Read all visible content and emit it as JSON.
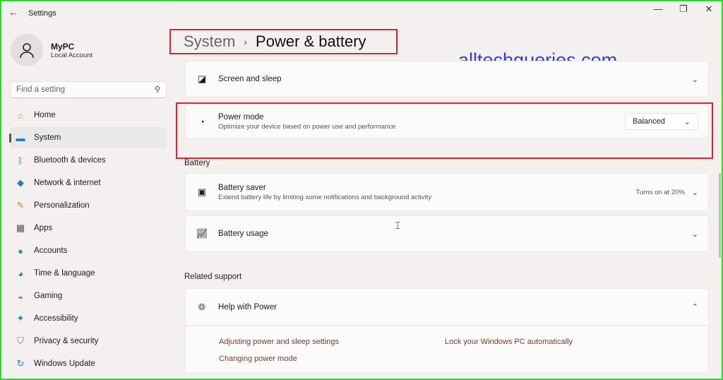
{
  "window": {
    "title": "Settings",
    "back_icon": "arrow-left-icon",
    "controls": [
      "minimize-icon",
      "maximize-icon",
      "close-icon"
    ]
  },
  "user": {
    "name": "MyPC",
    "account": "Local Account"
  },
  "search": {
    "placeholder": "Find a setting"
  },
  "sidebar": {
    "items": [
      {
        "label": "Home",
        "icon": "home-icon",
        "color": "#e8862e"
      },
      {
        "label": "System",
        "icon": "system-icon",
        "color": "#1f7fd6",
        "selected": true
      },
      {
        "label": "Bluetooth & devices",
        "icon": "bluetooth-icon",
        "color": "#1f7fd6"
      },
      {
        "label": "Network & internet",
        "icon": "wifi-icon",
        "color": "#1f7fd6"
      },
      {
        "label": "Personalization",
        "icon": "brush-icon",
        "color": "#d9822b"
      },
      {
        "label": "Apps",
        "icon": "apps-icon",
        "color": "#555"
      },
      {
        "label": "Accounts",
        "icon": "accounts-icon",
        "color": "#2aa876"
      },
      {
        "label": "Time & language",
        "icon": "globe-clock-icon",
        "color": "#1f7fd6"
      },
      {
        "label": "Gaming",
        "icon": "gamepad-icon",
        "color": "#777"
      },
      {
        "label": "Accessibility",
        "icon": "accessibility-icon",
        "color": "#1f7fd6"
      },
      {
        "label": "Privacy & security",
        "icon": "shield-icon",
        "color": "#777"
      },
      {
        "label": "Windows Update",
        "icon": "update-icon",
        "color": "#1f7fd6"
      }
    ]
  },
  "breadcrumb": {
    "parent": "System",
    "separator": "›",
    "current": "Power & battery"
  },
  "watermark": "alltechqueries.com",
  "cards": {
    "screen_sleep": {
      "title": "Screen and sleep"
    },
    "power_mode": {
      "title": "Power mode",
      "subtitle": "Optimize your device based on power use and performance",
      "value": "Balanced"
    },
    "battery_saver": {
      "title": "Battery saver",
      "subtitle": "Extend battery life by limiting some notifications and background activity",
      "status": "Turns on at 20%"
    },
    "battery_usage": {
      "title": "Battery usage"
    },
    "help": {
      "title": "Help with Power",
      "links": [
        "Adjusting power and sleep settings",
        "Lock your Windows PC automatically",
        "Changing power mode"
      ]
    }
  },
  "sections": {
    "battery": "Battery",
    "related": "Related support"
  },
  "colors": {
    "highlight_box": "#e3202a",
    "frame": "#2bd92b",
    "watermark": "#2f3fd6"
  }
}
